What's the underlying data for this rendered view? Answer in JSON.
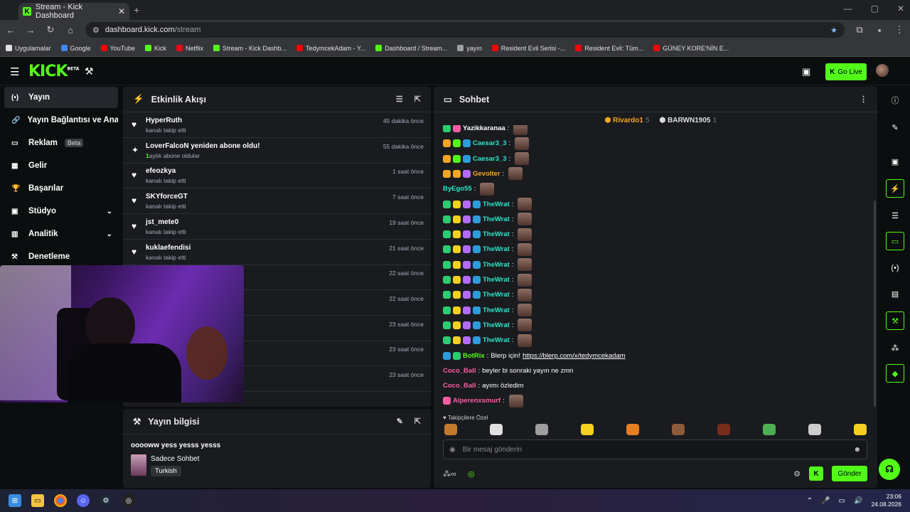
{
  "browser": {
    "tab_title": "Stream - Kick Dashboard",
    "new_tab": "+",
    "url_host": "dashboard.kick.com",
    "url_path": "/stream",
    "bookmarks": [
      {
        "label": "Uygulamalar",
        "color": "#e0e0e0"
      },
      {
        "label": "Google",
        "color": "#4285f4"
      },
      {
        "label": "YouTube",
        "color": "#ff0000"
      },
      {
        "label": "Kick",
        "color": "#53fc18"
      },
      {
        "label": "Netflix",
        "color": "#e50914"
      },
      {
        "label": "Stream - Kick Dashb...",
        "color": "#53fc18"
      },
      {
        "label": "TedymcekAdam - Y...",
        "color": "#ff0000"
      },
      {
        "label": "Dashboard / Stream...",
        "color": "#53fc18"
      },
      {
        "label": "yayın",
        "color": "#9aa0a6"
      },
      {
        "label": "Resident Evil Serisi -...",
        "color": "#ff0000"
      },
      {
        "label": "Resident Evil: Tüm...",
        "color": "#ff0000"
      },
      {
        "label": "GÜNEY KORE'NİN E...",
        "color": "#ff0000"
      }
    ]
  },
  "header": {
    "logo": "KICK",
    "logo_sup": "BETA",
    "go_live": "Go Live"
  },
  "sidebar": {
    "items": [
      {
        "label": "Yayın",
        "icon": "broadcast-icon",
        "glyph": "(•)"
      },
      {
        "label": "Yayın Bağlantısı ve Anahtarı",
        "icon": "link-icon",
        "glyph": "🔗"
      },
      {
        "label": "Reklam",
        "icon": "ad-icon",
        "glyph": "▭",
        "badge": "Beta"
      },
      {
        "label": "Gelir",
        "icon": "revenue-icon",
        "glyph": "▦"
      },
      {
        "label": "Başarılar",
        "icon": "trophy-icon",
        "glyph": "🏆"
      },
      {
        "label": "Stüdyo",
        "icon": "studio-icon",
        "glyph": "▣",
        "chevron": true
      },
      {
        "label": "Analitik",
        "icon": "analytics-icon",
        "glyph": "▥",
        "chevron": true
      },
      {
        "label": "Denetleme",
        "icon": "moderation-icon",
        "glyph": "⚒"
      }
    ]
  },
  "activity": {
    "title": "Etkinlik Akışı",
    "rows": [
      {
        "name": "HyperRuth",
        "sub": "kanalı takip etti",
        "time": "45 dakika önce",
        "icon": "heart"
      },
      {
        "name": "LoverFalcoN yeniden abone oldu!",
        "sub_count": "1",
        "sub": "aylık abone oldular",
        "time": "55 dakika önce",
        "icon": "sparkle"
      },
      {
        "name": "efeozkya",
        "sub": "kanalı takip etti",
        "time": "1 saat önce",
        "icon": "heart"
      },
      {
        "name": "SKYforceGT",
        "sub": "kanalı takip etti",
        "time": "7 saat önce",
        "icon": "heart"
      },
      {
        "name": "jst_mete0",
        "sub": "kanalı takip etti",
        "time": "19 saat önce",
        "icon": "heart"
      },
      {
        "name": "kuklaefendisi",
        "sub": "kanalı takip etti",
        "time": "21 saat önce",
        "icon": "heart"
      },
      {
        "name": "",
        "sub": "",
        "time": "22 saat önce",
        "icon": ""
      },
      {
        "name": "",
        "sub": "",
        "time": "22 saat önce",
        "icon": ""
      },
      {
        "name": "",
        "sub": "",
        "time": "23 saat önce",
        "icon": ""
      },
      {
        "name": "",
        "sub": "",
        "time": "23 saat önce",
        "icon": ""
      },
      {
        "name": "",
        "sub": "",
        "time": "23 saat önce",
        "icon": ""
      }
    ]
  },
  "stream_info": {
    "title": "Yayın bilgisi",
    "stream_title": "ooooww yess yesss yesss",
    "category": "Sadece Sohbet",
    "language": "Turkish"
  },
  "chat": {
    "title": "Sohbet",
    "pinned": [
      {
        "name": "Rivardo1",
        "count": "5"
      },
      {
        "name": "BARWN1905",
        "count": "1"
      }
    ],
    "messages": [
      {
        "user": "Yazikkaranaa",
        "color": "#ffffff",
        "text": "",
        "emote": true,
        "badges": [
          "#2ecc71",
          "#ff5da2"
        ]
      },
      {
        "user": "Caesar3_3",
        "color": "#2ee5c8",
        "text": "",
        "emote": true,
        "badges": [
          "#f5a623",
          "#53fc18",
          "#2d9cdb"
        ]
      },
      {
        "user": "Caesar3_3",
        "color": "#2ee5c8",
        "text": "",
        "emote": true,
        "badges": [
          "#f5a623",
          "#53fc18",
          "#2d9cdb"
        ]
      },
      {
        "user": "Gevolter",
        "color": "#f5a623",
        "text": "",
        "emote": true,
        "badges": [
          "#f5a623",
          "#f5a623",
          "#b36bff"
        ]
      },
      {
        "user": "ByEgo55",
        "color": "#2ee5c8",
        "text": "",
        "emote": true,
        "badges": []
      },
      {
        "user": "TheWrat",
        "color": "#2ee5c8",
        "text": "",
        "emote": true,
        "badges": [
          "#2ecc71",
          "#f5d020",
          "#b36bff",
          "#2d9cdb"
        ]
      },
      {
        "user": "TheWrat",
        "color": "#2ee5c8",
        "text": "",
        "emote": true,
        "badges": [
          "#2ecc71",
          "#f5d020",
          "#b36bff",
          "#2d9cdb"
        ]
      },
      {
        "user": "TheWrat",
        "color": "#2ee5c8",
        "text": "",
        "emote": true,
        "badges": [
          "#2ecc71",
          "#f5d020",
          "#b36bff",
          "#2d9cdb"
        ]
      },
      {
        "user": "TheWrat",
        "color": "#2ee5c8",
        "text": "",
        "emote": true,
        "badges": [
          "#2ecc71",
          "#f5d020",
          "#b36bff",
          "#2d9cdb"
        ]
      },
      {
        "user": "TheWrat",
        "color": "#2ee5c8",
        "text": "",
        "emote": true,
        "badges": [
          "#2ecc71",
          "#f5d020",
          "#b36bff",
          "#2d9cdb"
        ]
      },
      {
        "user": "TheWrat",
        "color": "#2ee5c8",
        "text": "",
        "emote": true,
        "badges": [
          "#2ecc71",
          "#f5d020",
          "#b36bff",
          "#2d9cdb"
        ]
      },
      {
        "user": "TheWrat",
        "color": "#2ee5c8",
        "text": "",
        "emote": true,
        "badges": [
          "#2ecc71",
          "#f5d020",
          "#b36bff",
          "#2d9cdb"
        ]
      },
      {
        "user": "TheWrat",
        "color": "#2ee5c8",
        "text": "",
        "emote": true,
        "badges": [
          "#2ecc71",
          "#f5d020",
          "#b36bff",
          "#2d9cdb"
        ]
      },
      {
        "user": "TheWrat",
        "color": "#2ee5c8",
        "text": "",
        "emote": true,
        "badges": [
          "#2ecc71",
          "#f5d020",
          "#b36bff",
          "#2d9cdb"
        ]
      },
      {
        "user": "TheWrat",
        "color": "#2ee5c8",
        "text": "",
        "emote": true,
        "badges": [
          "#2ecc71",
          "#f5d020",
          "#b36bff",
          "#2d9cdb"
        ]
      },
      {
        "user": "BotRix",
        "color": "#53fc18",
        "text": "Blerp için! ",
        "link": "https://blerp.com/x/tedymcekadam",
        "emote": false,
        "badges": [
          "#2d9cdb",
          "#2ecc71"
        ]
      },
      {
        "user": "Coco_Ball",
        "color": "#ff5da2",
        "text": "beyler bi sonraki yayın ne zmn",
        "emote": false,
        "badges": []
      },
      {
        "user": "Coco_Ball",
        "color": "#ff5da2",
        "text": "ayımı özledim",
        "emote": false,
        "badges": []
      },
      {
        "user": "Alperenxsmurf",
        "color": "#ff5da2",
        "text": "",
        "emote": true,
        "badges": [
          "#ff5da2"
        ]
      }
    ],
    "emote_label": "♥ Takipçilere Özel",
    "emote_colors": [
      "#c47a2c",
      "#e0e0e0",
      "#9e9e9e",
      "#f5d020",
      "#e67e22",
      "#8d5a3a",
      "#7a2c1a",
      "#4caf50",
      "#cccccc",
      "#f5d020"
    ],
    "input_placeholder": "Bir mesaj gönderin",
    "send": "Gönder"
  },
  "taskbar": {
    "time": "23:06",
    "date": "24.08.2026"
  }
}
